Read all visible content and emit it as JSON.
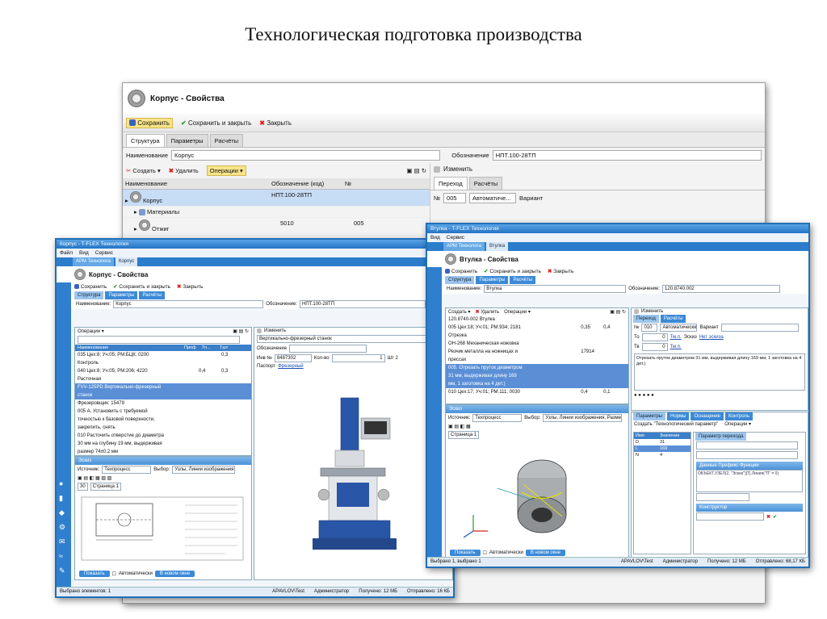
{
  "slide": {
    "title": "Технологическая подготовка производства"
  },
  "back_window": {
    "title": "Корпус - Свойства",
    "toolbar": {
      "save": "Сохранить",
      "save_close": "Сохранить и закрыть",
      "close": "Закрыть"
    },
    "tabs": [
      "Структура",
      "Параметры",
      "Расчёты"
    ],
    "name_label": "Наименование",
    "name_value": "Корпус",
    "designation_label": "Обозначение",
    "designation_value": "НПТ.100-28ТП",
    "tree_toolbar": {
      "create": "Создать",
      "delete": "Удалить",
      "operations": "Операции"
    },
    "columns": [
      "Наименование",
      "Обозначение (код)",
      "№"
    ],
    "rows": [
      {
        "name": "Корпус",
        "code": "НПТ.100-28ТП",
        "num": ""
      },
      {
        "name": "Материалы",
        "code": "",
        "num": ""
      },
      {
        "name": "Отжиг",
        "code": "5010",
        "num": "005"
      }
    ],
    "right_panel": {
      "change": "Изменить",
      "tabs": [
        "Переход",
        "Расчёты"
      ],
      "num_label": "№",
      "num_value": "005",
      "mode_value": "Автоматиче...",
      "variant_label": "Вариант"
    }
  },
  "window_left": {
    "titlebar": "Корпус - T-FLEX Технология",
    "menu": [
      "Файл",
      "Вид",
      "Сервис"
    ],
    "doc_tabs": [
      "АРМ Технолога",
      "Корпус"
    ],
    "title": "Корпус - Свойства",
    "toolbar": {
      "save": "Сохранить",
      "save_close": "Сохранить и закрыть",
      "close": "Закрыть"
    },
    "tabs": [
      "Структура",
      "Параметры",
      "Расчёты"
    ],
    "name_label": "Наименование:",
    "name_value": "Корпус",
    "designation_label": "Обозначение:",
    "designation_value": "НПТ.100-28ТП",
    "operations_label": "Операции",
    "columns": [
      "Наименование",
      "Проф",
      "Тп...",
      "Тшт"
    ],
    "tree": [
      {
        "text": "035  Цех:8; Уч:05; РМ:БЦК;  0200",
        "col2": "",
        "col3": "0,3",
        "sel": false
      },
      {
        "text": "Контроль",
        "col2": "",
        "col3": "",
        "sel": false
      },
      {
        "text": "040  Цех:8; Уч:05; РМ:206;  4220",
        "col2": "0,4",
        "col3": "0,3",
        "sel": false
      },
      {
        "text": "Расточная",
        "col2": "",
        "col3": "",
        "sel": false
      },
      {
        "text": "FVV-125PD  Вертикально-фрезерный",
        "col2": "",
        "col3": "",
        "sel": true
      },
      {
        "text": "станок",
        "col2": "",
        "col3": "",
        "sel": true
      },
      {
        "text": "Фрезеровщик:                    15479",
        "col2": "",
        "col3": "",
        "sel": false
      },
      {
        "text": "005  А. Установить с требуемой",
        "col2": "",
        "col3": "",
        "sel": false
      },
      {
        "text": "точностью к базовой поверхности,",
        "col2": "",
        "col3": "",
        "sel": false
      },
      {
        "text": "закрепить, снять",
        "col2": "",
        "col3": "",
        "sel": false
      },
      {
        "text": "010  Расточить отверстие до диаметра",
        "col2": "",
        "col3": "",
        "sel": false
      },
      {
        "text": "30 мм на глубину 19 мм, выдерживая",
        "col2": "",
        "col3": "",
        "sel": false
      },
      {
        "text": "размер 74±0,2 мм",
        "col2": "",
        "col3": "",
        "sel": false
      }
    ],
    "sketch_panel": {
      "header": "Эскиз",
      "source_label": "Источник:",
      "source_value": "Техпроцесс",
      "select_label": "Выбор:",
      "select_value": "Узлы, Линии изображения,",
      "page_num": "30",
      "page_tab": "Страница 1",
      "show_btn": "Показать",
      "auto_label": "Автоматически",
      "new_window_btn": "В новом окне"
    },
    "right_panel": {
      "change": "Изменить",
      "equipment_name": "Вертикально-фрезерный станок",
      "designation_label": "Обозначение",
      "inv_label": "Инв №",
      "inv_value": "8487302",
      "qty_label": "Кол-во",
      "qty_value": "1",
      "unit_value": "Шт 2",
      "passport_label": "Паспорт",
      "passport_link": "Фрезерный"
    },
    "status": {
      "selected": "Выбрано элементов: 1",
      "user": "APAVLOV\\Test",
      "role": "Администратор",
      "received": "Получено: 12 МБ",
      "sent": "Отправлено: 16 КБ"
    }
  },
  "window_right": {
    "titlebar": "Втулка - T-FLEX Технология",
    "menu": [
      "Вид",
      "Сервис"
    ],
    "doc_tabs": [
      "АРМ Технолога",
      "Втулка"
    ],
    "title": "Втулка - Свойства",
    "toolbar": {
      "save": "Сохранить",
      "save_close": "Сохранить и закрыть",
      "close": "Закрыть"
    },
    "tabs": [
      "Структура",
      "Параметры",
      "Расчёты"
    ],
    "name_label": "Наименование:",
    "name_value": "Втулка",
    "designation_label": "Обозначение:",
    "designation_value": "120.8740.002",
    "tree_toolbar": {
      "create": "Создать",
      "delete": "Удалить",
      "operations": "Операции"
    },
    "tree": [
      {
        "text": "120.8740-002  Втулка",
        "col2": "",
        "col3": "",
        "sel": false
      },
      {
        "text": "005  Цех:18; Уч:01; РМ:934;  2181",
        "col2": "0,35",
        "col3": "0,4",
        "sel": false
      },
      {
        "text": "Отрезка",
        "col2": "",
        "col3": "",
        "sel": false
      },
      {
        "text": "ОН-268  Механическая ножовка",
        "col2": "",
        "col3": "",
        "sel": false
      },
      {
        "text": "Резчик металла на ножницах и",
        "col2": "17914",
        "col3": "",
        "sel": false
      },
      {
        "text": "прессах",
        "col2": "",
        "col3": "",
        "sel": false
      },
      {
        "text": "005. Отрезать пруток диаметром",
        "col2": "",
        "col3": "",
        "sel": true
      },
      {
        "text": "31 мм, выдерживая длину 169",
        "col2": "",
        "col3": "",
        "sel": true
      },
      {
        "text": "мм, 1 заготовка на 4 дет.)",
        "col2": "",
        "col3": "",
        "sel": true
      },
      {
        "text": "010  Цех:17; Уч:01; РМ:111;  0030",
        "col2": "0,4",
        "col3": "0,1",
        "sel": false
      }
    ],
    "right_panel": {
      "change": "Изменить",
      "tabs": [
        "Переход",
        "Расчёты"
      ],
      "num_label": "№",
      "num_value": "010",
      "mode_value": "Автоматически",
      "variant_label": "Вариант",
      "to_label": "То",
      "to_value": "0",
      "to_unit": "Тм.п.",
      "tv_label": "Тв",
      "tv_value": "0",
      "tv_unit": "Тм.п.",
      "sketch_label": "Эскиз",
      "sketch_link": "Нет эскиза",
      "description": "Отрезать пруток диаметром 31 мм, выдерживая длину 169 мм; 1 заготовка на 4 дет.)"
    },
    "sketch_panel": {
      "header": "Эскиз",
      "source_label": "Источник:",
      "source_value": "Техпроцесс",
      "select_label": "Выбор:",
      "select_value": "Узлы, Линии изображения, Разме...",
      "page_tab": "Страница 1",
      "show_btn": "Показать",
      "auto_label": "Автоматически",
      "new_window_btn": "В новом окне"
    },
    "params_panel": {
      "tabs": [
        "Параметры",
        "Нормы",
        "Оснащение",
        "Контроль"
      ],
      "create_btn": "Создать \"Технологический параметр\"",
      "operations": "Операции",
      "columns": [
        "Имя",
        "Значение"
      ],
      "rows": [
        {
          "name": "D",
          "value": "31"
        },
        {
          "name": "L",
          "value": "169"
        },
        {
          "name": "N",
          "value": "4"
        }
      ],
      "param_tab": "Параметр перехода",
      "formula_hdr": "Данные   Префикс   Функции",
      "formula_text": "ОБЪЕКТ.УЗЕЛ(2, \"Эскиз\")[T].Линия(\"П\" = 0)",
      "constructor": "Конструктор"
    },
    "status": {
      "selected": "Выбрано 1, выбрано 1",
      "user": "APAVLOV\\Test",
      "role": "Администратор",
      "received": "Получено: 12 МБ",
      "sent": "Отправлено: 68,17 КБ"
    }
  }
}
